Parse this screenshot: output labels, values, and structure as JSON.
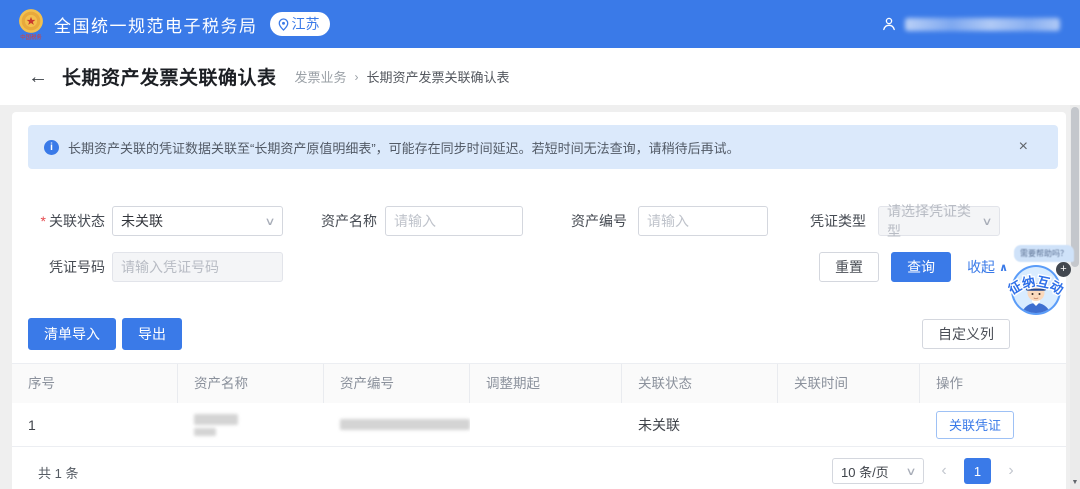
{
  "icons": {
    "back": "←",
    "crumb_sep": "›",
    "info": "i",
    "close": "×",
    "chevron_down": "∨",
    "chevron_up": "∧",
    "prev": "‹",
    "next": "›",
    "scroll_down": "▼",
    "plus": "+",
    "required": "*"
  },
  "topbar": {
    "title": "全国统一规范电子税务局",
    "region": "江苏",
    "logo_caption": "中国税务"
  },
  "breadcrumb": {
    "page_title": "长期资产发票关联确认表",
    "parent": "发票业务",
    "current": "长期资产发票关联确认表"
  },
  "notice": {
    "text": "长期资产关联的凭证数据关联至“长期资产原值明细表”，可能存在同步时间延迟。若短时间无法查询，请稍待后再试。"
  },
  "filters": {
    "status": {
      "label": "关联状态",
      "value": "未关联"
    },
    "asset_name": {
      "label": "资产名称",
      "placeholder": "请输入"
    },
    "asset_no": {
      "label": "资产编号",
      "placeholder": "请输入"
    },
    "voucher_type": {
      "label": "凭证类型",
      "placeholder": "请选择凭证类型"
    },
    "voucher_no": {
      "label": "凭证号码",
      "placeholder": "请输入凭证号码"
    },
    "reset": "重置",
    "search": "查询",
    "collapse": "收起"
  },
  "toolbar": {
    "import": "清单导入",
    "export": "导出",
    "customize": "自定义列"
  },
  "table": {
    "columns": [
      "序号",
      "资产名称",
      "资产编号",
      "调整期起",
      "关联状态",
      "关联时间",
      "操作"
    ],
    "rows": [
      {
        "seq": "1",
        "status": "未关联",
        "action": "关联凭证"
      }
    ]
  },
  "pagination": {
    "total": "共 1 条",
    "page_size": "10 条/页",
    "page": "1"
  },
  "assistant": {
    "bubble": "需要帮助吗？",
    "badge": "征纳互动"
  }
}
